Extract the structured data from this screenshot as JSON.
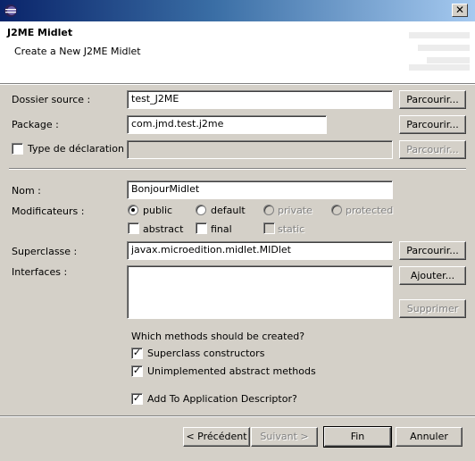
{
  "window": {
    "close_glyph": "✕",
    "icon": "eclipse-icon"
  },
  "header": {
    "title": "J2ME Midlet",
    "description": "Create a New J2ME Midlet"
  },
  "form": {
    "source_folder": {
      "label": "Dossier source :",
      "value": "test_J2ME",
      "browse": "Parcourir..."
    },
    "package": {
      "label": "Package :",
      "value": "com.jmd.test.j2me",
      "browse": "Parcourir..."
    },
    "enclosing_type": {
      "label": "Type de déclaration :",
      "value": "",
      "browse": "Parcourir...",
      "checked": false
    },
    "name": {
      "label": "Nom :",
      "value": "BonjourMidlet"
    },
    "modifiers": {
      "label": "Modificateurs :",
      "public": "public",
      "default": "default",
      "private": "private",
      "protected": "protected",
      "abstract": "abstract",
      "final": "final",
      "static": "static",
      "selected": "public"
    },
    "superclass": {
      "label": "Superclasse :",
      "value": "javax.microedition.midlet.MIDlet",
      "browse": "Parcourir..."
    },
    "interfaces": {
      "label": "Interfaces :",
      "add": "Ajouter...",
      "remove": "Supprimer"
    },
    "methods": {
      "question": "Which methods should be created?",
      "superclass_constructors": "Superclass constructors",
      "abstract_methods": "Unimplemented abstract methods",
      "add_descriptor": "Add To Application Descriptor?"
    }
  },
  "footer": {
    "back": "< Précédent",
    "next": "Suivant >",
    "finish": "Fin",
    "cancel": "Annuler"
  }
}
